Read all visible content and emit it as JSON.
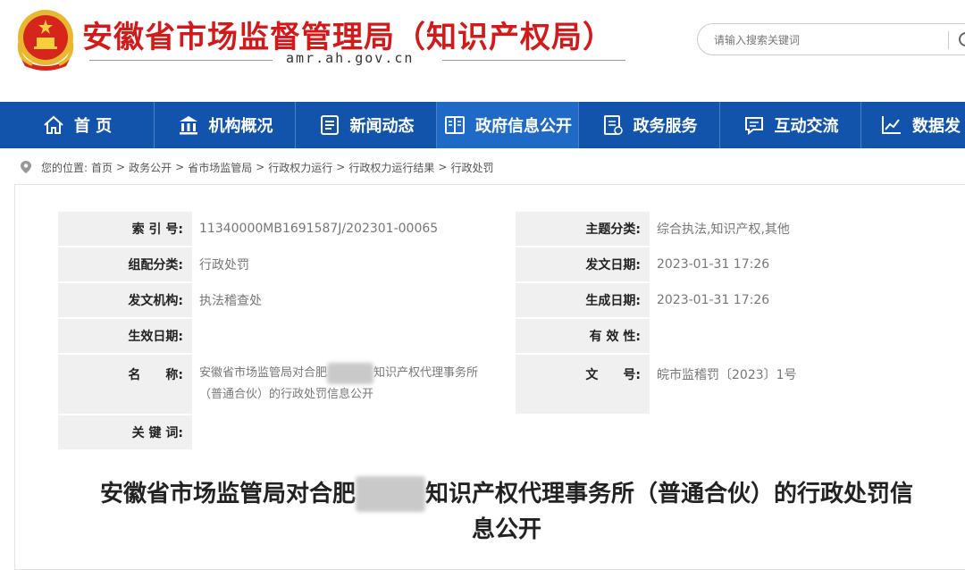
{
  "header": {
    "site_title": "安徽省市场监督管理局（知识产权局）",
    "domain": "amr.ah.gov.cn",
    "search_placeholder": "请输入搜索关键词",
    "brand_color": "#d21a1a"
  },
  "nav": {
    "color": "#1254ab",
    "items": [
      {
        "label": "首 页",
        "icon": "home-icon"
      },
      {
        "label": "机构概况",
        "icon": "building-icon"
      },
      {
        "label": "新闻动态",
        "icon": "news-icon"
      },
      {
        "label": "政府信息公开",
        "icon": "book-icon",
        "active": true
      },
      {
        "label": "政务服务",
        "icon": "document-icon"
      },
      {
        "label": "互动交流",
        "icon": "chat-icon"
      },
      {
        "label": "数据发",
        "icon": "chart-icon"
      }
    ]
  },
  "breadcrumb": {
    "prefix": "您的位置:",
    "items": [
      "首页",
      "政务公开",
      "省市场监管局",
      "行政权力运行",
      "行政权力运行结果",
      "行政处罚"
    ],
    "separator": ">"
  },
  "meta": {
    "index_label": "索 引 号:",
    "index_value": "11340000MB1691587J/202301-00065",
    "topic_label": "主题分类:",
    "topic_value": "综合执法,知识产权,其他",
    "category_label": "组配分类:",
    "category_value": "行政处罚",
    "issue_date_label": "发文日期:",
    "issue_date_value": "2023-01-31 17:26",
    "org_label": "发文机构:",
    "org_value": "执法稽查处",
    "gen_date_label": "生成日期:",
    "gen_date_value": "2023-01-31 17:26",
    "effective_label": "生效日期:",
    "effective_value": "",
    "validity_label": "有 效 性:",
    "validity_value": "",
    "name_label": "名　　称:",
    "name_value_a": "安徽省市场监管局对合肥",
    "name_value_b": "知识产权代理事务所",
    "name_value_c": "（普通合伙）的行政处罚信息公开",
    "docno_label": "文　　号:",
    "docno_value": "皖市监稽罚〔2023〕1号",
    "keywords_label": "关 键 词:",
    "keywords_value": ""
  },
  "article": {
    "title_a": "安徽省市场监管局对合肥",
    "title_b": "知识产权代理事务所（普通合伙）的行政处罚信",
    "title_c": "息公开"
  }
}
